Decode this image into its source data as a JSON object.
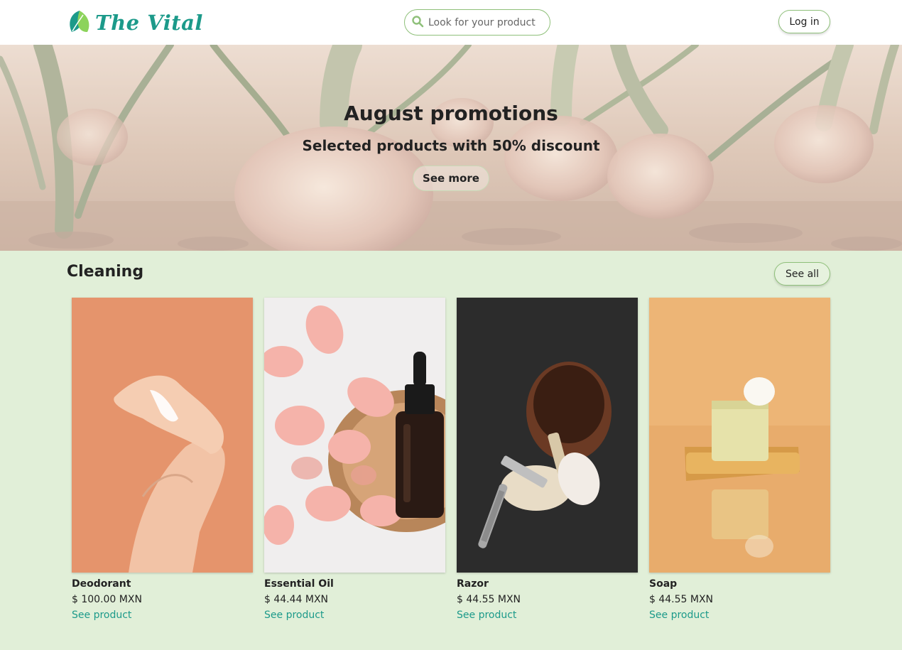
{
  "header": {
    "logo_text": "The Vital",
    "search_placeholder": "Look for your product",
    "login_label": "Log in"
  },
  "hero": {
    "title": "August promotions",
    "subtitle": "Selected products with 50% discount",
    "button_label": "See more"
  },
  "section": {
    "title": "Cleaning",
    "see_all_label": "See all"
  },
  "products": [
    {
      "name": "Deodorant",
      "price": "$ 100.00 MXN",
      "link": "See product"
    },
    {
      "name": "Essential Oil",
      "price": "$ 44.44 MXN",
      "link": "See product"
    },
    {
      "name": "Razor",
      "price": "$ 44.55 MXN",
      "link": "See product"
    },
    {
      "name": "Soap",
      "price": "$ 44.55 MXN",
      "link": "See product"
    }
  ],
  "colors": {
    "brand": "#1c9a8a",
    "accent_border": "#8fc07a",
    "section_bg": "#e1efd8"
  },
  "icons": {
    "logo": "leaf-icon",
    "search": "search-icon"
  }
}
